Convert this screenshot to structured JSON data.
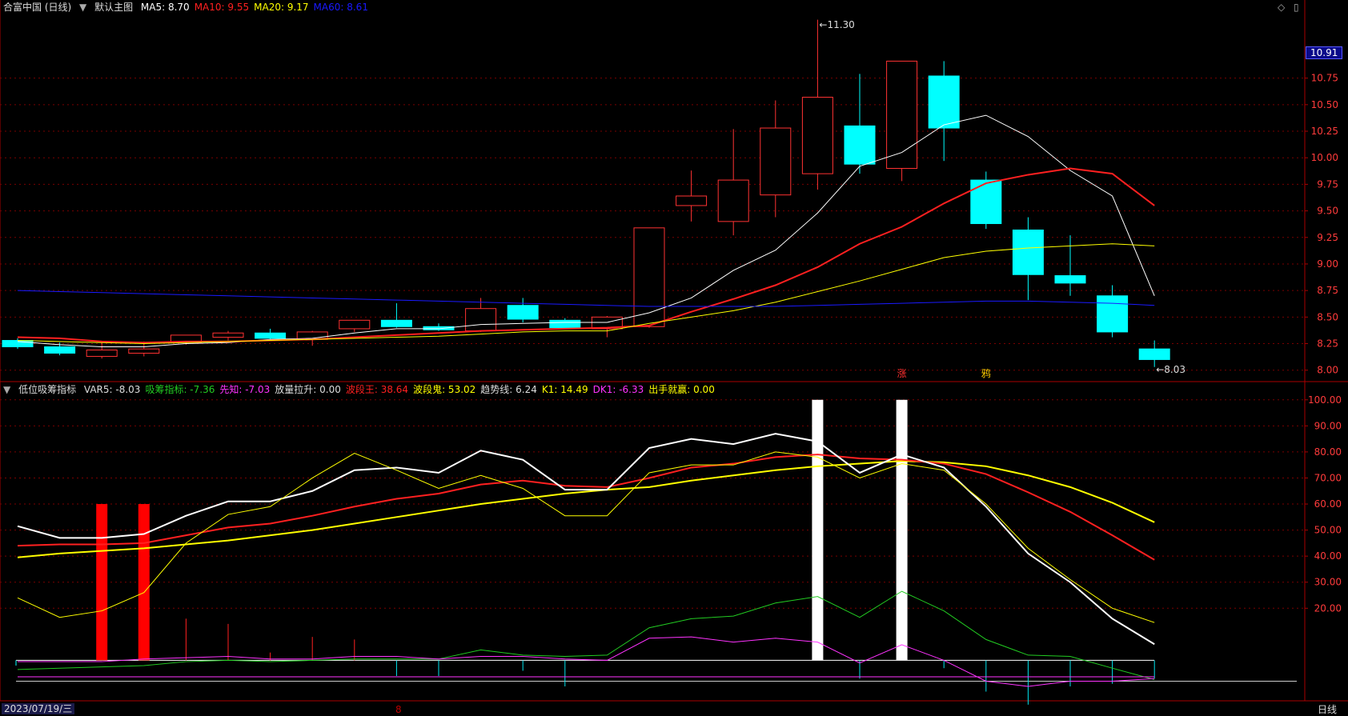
{
  "price_panel": {
    "stock": "合富中国 (日线)",
    "template": "默认主图",
    "ma_legend": [
      {
        "label": "MA5: 8.70",
        "color": "#ffffff"
      },
      {
        "label": "MA10: 9.55",
        "color": "#ff2020"
      },
      {
        "label": "MA20: 9.17",
        "color": "#ffff00"
      },
      {
        "label": "MA60: 8.61",
        "color": "#1a1aff"
      }
    ],
    "current_price_tag": "10.91",
    "high_label": "11.30",
    "low_label": "8.03",
    "markers": [
      {
        "text": "涨",
        "color": "#ff3030",
        "index": 21
      },
      {
        "text": "鸦",
        "color": "#ffcc00",
        "index": 23
      }
    ]
  },
  "indicator_panel": {
    "name": "低位吸筹指标",
    "legend": [
      {
        "label": "VAR5: -8.03",
        "color": "#dddddd"
      },
      {
        "label": "吸筹指标: -7.36",
        "color": "#22cc22"
      },
      {
        "label": "先知: -7.03",
        "color": "#ff33ff"
      },
      {
        "label": "放量拉升: 0.00",
        "color": "#dddddd"
      },
      {
        "label": "波段王: 38.64",
        "color": "#ff2020"
      },
      {
        "label": "波段鬼: 53.02",
        "color": "#ffff00"
      },
      {
        "label": "趋势线: 6.24",
        "color": "#dddddd"
      },
      {
        "label": "K1: 14.49",
        "color": "#ffff00"
      },
      {
        "label": "DK1: -6.33",
        "color": "#ff33ff"
      },
      {
        "label": "出手就赢: 0.00",
        "color": "#ffff00"
      }
    ]
  },
  "footer": {
    "date": "2023/07/19/三",
    "period": "日线",
    "month_mark": "8"
  },
  "colors": {
    "up": "#ff3232",
    "down": "#00ffff",
    "grid": "#7a0000",
    "axis": "#aa0000"
  },
  "icons": {
    "left": "chevron-down-icon",
    "right": [
      "diamond-icon",
      "panel-icon"
    ]
  },
  "chart_data": [
    {
      "type": "candlestick",
      "title": "合富中国 (日线)",
      "y_ticks": [
        8.0,
        8.25,
        8.5,
        8.75,
        9.0,
        9.25,
        9.5,
        9.75,
        10.0,
        10.25,
        10.5,
        10.75
      ],
      "ylim": [
        7.93,
        11.35
      ],
      "candles": [
        {
          "o": 8.28,
          "h": 8.3,
          "l": 8.2,
          "c": 8.22
        },
        {
          "o": 8.22,
          "h": 8.26,
          "l": 8.14,
          "c": 8.16
        },
        {
          "o": 8.13,
          "h": 8.26,
          "l": 8.11,
          "c": 8.19
        },
        {
          "o": 8.16,
          "h": 8.27,
          "l": 8.13,
          "c": 8.2
        },
        {
          "o": 8.26,
          "h": 8.33,
          "l": 8.24,
          "c": 8.33
        },
        {
          "o": 8.31,
          "h": 8.37,
          "l": 8.28,
          "c": 8.35
        },
        {
          "o": 8.35,
          "h": 8.39,
          "l": 8.28,
          "c": 8.3
        },
        {
          "o": 8.29,
          "h": 8.37,
          "l": 8.23,
          "c": 8.36
        },
        {
          "o": 8.39,
          "h": 8.47,
          "l": 8.36,
          "c": 8.47
        },
        {
          "o": 8.47,
          "h": 8.63,
          "l": 8.4,
          "c": 8.41
        },
        {
          "o": 8.41,
          "h": 8.44,
          "l": 8.37,
          "c": 8.38
        },
        {
          "o": 8.37,
          "h": 8.68,
          "l": 8.36,
          "c": 8.58
        },
        {
          "o": 8.61,
          "h": 8.68,
          "l": 8.45,
          "c": 8.48
        },
        {
          "o": 8.47,
          "h": 8.49,
          "l": 8.39,
          "c": 8.4
        },
        {
          "o": 8.39,
          "h": 8.51,
          "l": 8.31,
          "c": 8.5
        },
        {
          "o": 8.41,
          "h": 9.34,
          "l": 8.4,
          "c": 9.34
        },
        {
          "o": 9.55,
          "h": 9.88,
          "l": 9.4,
          "c": 9.64
        },
        {
          "o": 9.4,
          "h": 10.27,
          "l": 9.27,
          "c": 9.79
        },
        {
          "o": 9.65,
          "h": 10.54,
          "l": 9.44,
          "c": 10.28
        },
        {
          "o": 9.85,
          "h": 11.3,
          "l": 9.7,
          "c": 10.57
        },
        {
          "o": 10.3,
          "h": 10.79,
          "l": 9.85,
          "c": 9.94
        },
        {
          "o": 9.9,
          "h": 10.91,
          "l": 9.78,
          "c": 10.91
        },
        {
          "o": 10.77,
          "h": 10.91,
          "l": 9.97,
          "c": 10.28
        },
        {
          "o": 9.79,
          "h": 9.87,
          "l": 9.33,
          "c": 9.38
        },
        {
          "o": 9.32,
          "h": 9.44,
          "l": 8.66,
          "c": 8.9
        },
        {
          "o": 8.89,
          "h": 9.27,
          "l": 8.7,
          "c": 8.82
        },
        {
          "o": 8.7,
          "h": 8.8,
          "l": 8.31,
          "c": 8.36
        },
        {
          "o": 8.2,
          "h": 8.28,
          "l": 8.03,
          "c": 8.1
        }
      ],
      "series": [
        {
          "name": "MA5",
          "color": "#ffffff",
          "values": [
            8.27,
            8.24,
            8.22,
            8.22,
            8.25,
            8.26,
            8.29,
            8.3,
            8.35,
            8.39,
            8.39,
            8.43,
            8.44,
            8.45,
            8.45,
            8.54,
            8.68,
            8.94,
            9.13,
            9.48,
            9.92,
            10.05,
            10.31,
            10.4,
            10.2,
            9.88,
            9.64,
            8.7
          ]
        },
        {
          "name": "MA10",
          "color": "#ff2020",
          "values": [
            8.31,
            8.3,
            8.27,
            8.26,
            8.27,
            8.27,
            8.28,
            8.29,
            8.31,
            8.33,
            8.35,
            8.37,
            8.38,
            8.39,
            8.4,
            8.42,
            8.55,
            8.67,
            8.8,
            8.97,
            9.19,
            9.35,
            9.57,
            9.76,
            9.84,
            9.9,
            9.85,
            9.55
          ]
        },
        {
          "name": "MA20",
          "color": "#ffff00",
          "values": [
            8.28,
            8.27,
            8.26,
            8.25,
            8.26,
            8.27,
            8.28,
            8.29,
            8.3,
            8.31,
            8.32,
            8.34,
            8.36,
            8.37,
            8.37,
            8.44,
            8.5,
            8.56,
            8.64,
            8.74,
            8.84,
            8.95,
            9.06,
            9.12,
            9.15,
            9.17,
            9.19,
            9.17
          ]
        },
        {
          "name": "MA60",
          "color": "#1a1aff",
          "values": [
            8.75,
            8.74,
            8.73,
            8.72,
            8.71,
            8.7,
            8.69,
            8.68,
            8.67,
            8.66,
            8.65,
            8.64,
            8.63,
            8.62,
            8.61,
            8.6,
            8.6,
            8.6,
            8.6,
            8.61,
            8.62,
            8.63,
            8.64,
            8.65,
            8.65,
            8.64,
            8.63,
            8.61
          ]
        }
      ]
    },
    {
      "type": "line",
      "title": "低位吸筹指标",
      "y_ticks": [
        20,
        30,
        40,
        50,
        60,
        70,
        80,
        90,
        100
      ],
      "ylim": [
        -10,
        103
      ],
      "series": [
        {
          "name": "波段鬼",
          "color": "#ffff00",
          "width": 2,
          "values": [
            39.5,
            41.0,
            42.0,
            43.0,
            44.5,
            46.0,
            48.0,
            50.0,
            52.5,
            55.0,
            57.5,
            60.0,
            62.0,
            64.0,
            65.5,
            66.5,
            69.0,
            71.0,
            73.0,
            74.5,
            75.5,
            76.5,
            76.0,
            74.5,
            71.0,
            66.5,
            60.5,
            53.0
          ]
        },
        {
          "name": "波段王",
          "color": "#ff2020",
          "width": 2,
          "values": [
            44.0,
            44.5,
            44.5,
            45.0,
            48.0,
            51.0,
            52.5,
            55.5,
            59.0,
            62.0,
            64.0,
            67.5,
            69.0,
            67.0,
            66.5,
            70.0,
            74.0,
            75.5,
            78.0,
            79.0,
            77.5,
            77.0,
            75.5,
            71.5,
            64.5,
            57.0,
            48.0,
            38.6
          ]
        },
        {
          "name": "VAR5",
          "color": "#ffffff",
          "width": 2,
          "values": [
            51.5,
            47.0,
            47.0,
            48.5,
            55.5,
            61.0,
            61.0,
            65.0,
            73.0,
            74.0,
            72.0,
            80.5,
            77.0,
            65.5,
            65.5,
            81.5,
            85.0,
            83.0,
            87.0,
            84.0,
            72.0,
            79.0,
            74.0,
            59.0,
            41.0,
            30.0,
            16.0,
            6.2
          ]
        },
        {
          "name": "K1",
          "color": "#ffff00",
          "width": 1,
          "values": [
            24.0,
            16.5,
            19.0,
            26.0,
            45.0,
            56.0,
            59.0,
            70.0,
            79.5,
            73.0,
            66.0,
            71.0,
            66.0,
            55.5,
            55.5,
            72.0,
            75.0,
            75.0,
            80.0,
            78.0,
            70.0,
            75.5,
            73.0,
            60.0,
            43.0,
            31.0,
            20.0,
            14.5
          ]
        },
        {
          "name": "吸筹指标",
          "color": "#22cc22",
          "width": 1,
          "values": [
            -3.5,
            -3.0,
            -2.5,
            -2.0,
            -0.5,
            0.0,
            -0.5,
            0.0,
            0.5,
            0.5,
            0.5,
            4.0,
            2.0,
            1.5,
            2.0,
            12.5,
            16.0,
            17.0,
            22.0,
            24.5,
            16.5,
            26.5,
            19.0,
            8.0,
            2.0,
            1.5,
            -3.0,
            -7.4
          ]
        },
        {
          "name": "先知",
          "color": "#ff33ff",
          "width": 1,
          "values": [
            -0.5,
            -0.5,
            -0.5,
            0.5,
            1.0,
            1.5,
            0.5,
            0.5,
            1.5,
            1.5,
            0.5,
            1.5,
            1.5,
            0.5,
            0.0,
            8.5,
            9.0,
            7.0,
            8.5,
            7.0,
            -1.0,
            6.0,
            0.0,
            -8.0,
            -10.0,
            -8.0,
            -8.0,
            -7.0
          ]
        },
        {
          "name": "DK1",
          "color": "#ff33ff",
          "width": 1,
          "values": [
            -6.3,
            -6.3,
            -6.3,
            -6.3,
            -6.3,
            -6.3,
            -6.3,
            -6.3,
            -6.3,
            -6.3,
            -6.3,
            -6.3,
            -6.3,
            -6.3,
            -6.3,
            -6.3,
            -6.3,
            -6.3,
            -6.3,
            -6.3,
            -6.3,
            -6.3,
            -6.3,
            -6.3,
            -6.3,
            -6.3,
            -6.3,
            -6.3
          ]
        }
      ],
      "bars": [
        {
          "name": "红柱",
          "color": "#ff0000",
          "index": [
            2,
            3
          ],
          "value": 60
        },
        {
          "name": "白柱",
          "color": "#ffffff",
          "index": [
            19,
            21
          ],
          "value": 100
        }
      ],
      "volume_spikes": [
        0,
        0,
        0,
        0,
        16,
        14,
        3,
        9,
        8,
        0,
        0,
        0,
        0,
        0,
        0,
        0,
        0,
        0,
        0,
        0,
        0,
        0,
        0,
        0,
        0,
        0,
        0,
        0
      ],
      "var5_sticks": [
        0,
        0,
        0,
        0,
        0,
        0,
        0,
        0,
        0,
        -6,
        -6,
        0,
        -4,
        -10,
        0,
        0,
        0,
        0,
        0,
        0,
        -7,
        0,
        -3,
        -12,
        -17,
        -10,
        -9,
        -7
      ]
    }
  ]
}
